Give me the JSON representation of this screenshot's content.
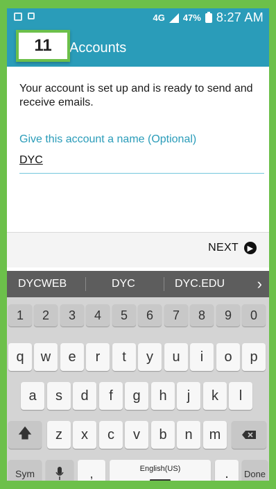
{
  "statusbar": {
    "network": "4G",
    "battery": "47%",
    "time": "8:27 AM"
  },
  "appbar": {
    "title": "Accounts"
  },
  "step_badge": "11",
  "content": {
    "message": "Your account is set up and is ready to send and receive emails.",
    "name_label": "Give this account a name (Optional)",
    "name_value": "DYC"
  },
  "next": {
    "label": "NEXT"
  },
  "suggestions": [
    "DYCWEB",
    "DYC",
    "DYC.EDU"
  ],
  "keyboard": {
    "numbers": [
      "1",
      "2",
      "3",
      "4",
      "5",
      "6",
      "7",
      "8",
      "9",
      "0"
    ],
    "row1": [
      "q",
      "w",
      "e",
      "r",
      "t",
      "y",
      "u",
      "i",
      "o",
      "p"
    ],
    "row2": [
      "a",
      "s",
      "d",
      "f",
      "g",
      "h",
      "j",
      "k",
      "l"
    ],
    "row3": [
      "z",
      "x",
      "c",
      "v",
      "b",
      "n",
      "m"
    ],
    "sym": "Sym",
    "space": "English(US)",
    "done": "Done",
    "comma": ",",
    "period": "."
  },
  "colors": {
    "frame": "#6cc04a",
    "appbar": "#2a9cb9",
    "accent": "#2a9cb9"
  }
}
